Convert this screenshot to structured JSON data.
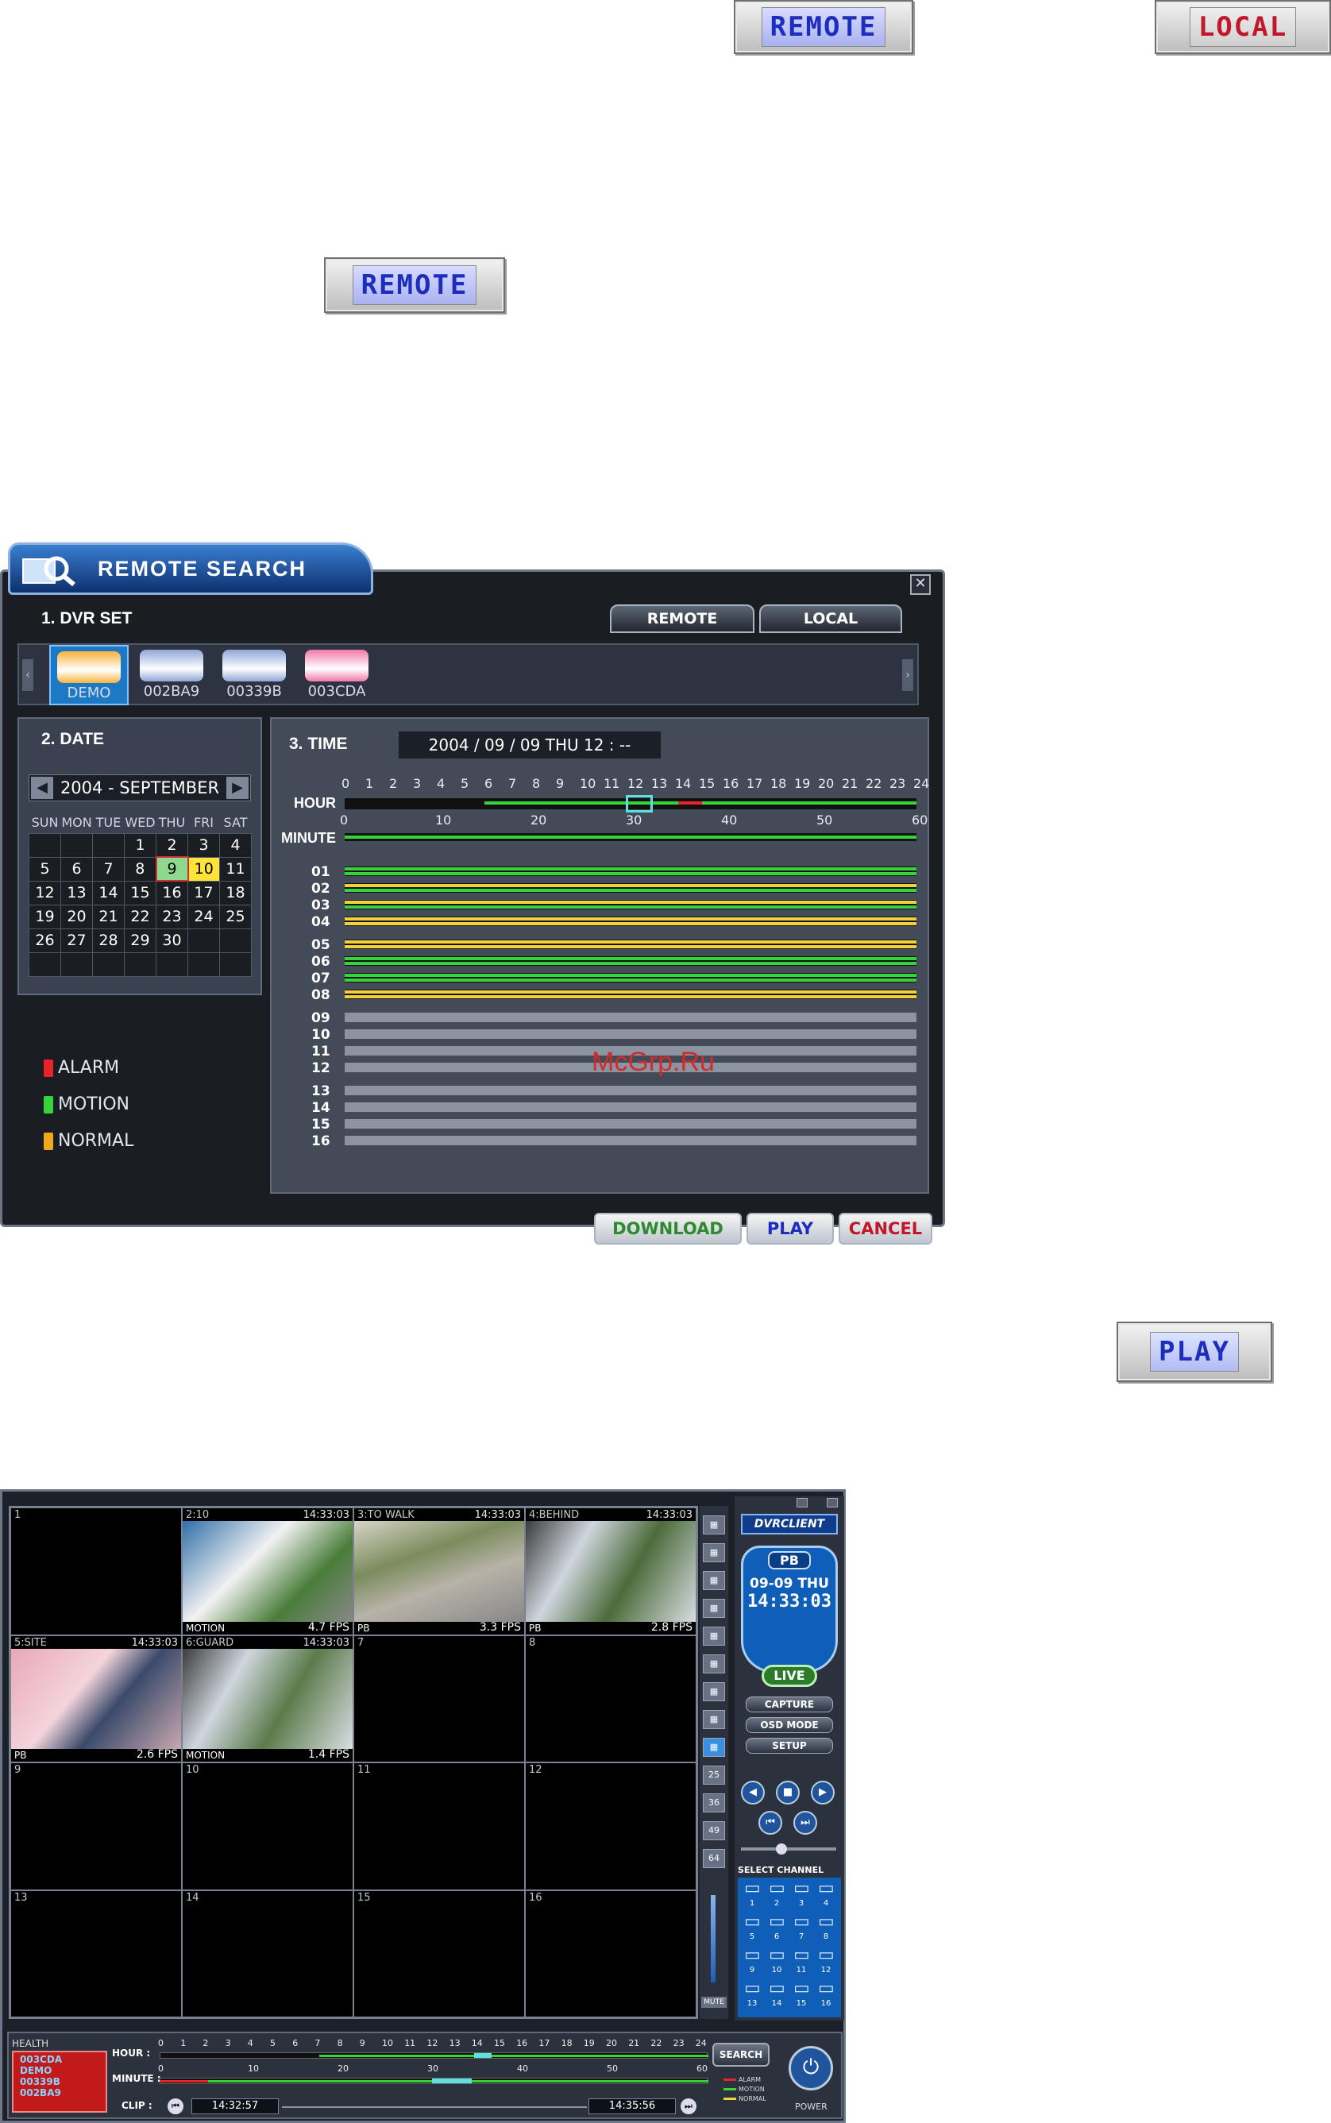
{
  "top_buttons": {
    "remote": "REMOTE",
    "local": "LOCAL",
    "remote2": "REMOTE",
    "play": "PLAY"
  },
  "dialog": {
    "title": "REMOTE SEARCH",
    "close": "✕",
    "section_dvr": "1. DVR SET",
    "tab_remote": "REMOTE",
    "tab_local": "LOCAL",
    "dvrs": [
      {
        "label": "DEMO",
        "color": "#f6b33a",
        "selected": true
      },
      {
        "label": "002BA9",
        "color": "#8ea6d8",
        "selected": false
      },
      {
        "label": "00339B",
        "color": "#8ea6d8",
        "selected": false
      },
      {
        "label": "003CDA",
        "color": "#f07aa8",
        "selected": false
      }
    ],
    "section_date": "2. DATE",
    "month": "2004 - SEPTEMBER",
    "weekdays": [
      "SUN",
      "MON",
      "TUE",
      "WED",
      "THU",
      "FRI",
      "SAT"
    ],
    "weeks": [
      [
        "",
        "",
        "",
        "1",
        "2",
        "3",
        "4"
      ],
      [
        "5",
        "6",
        "7",
        "8",
        "9",
        "10",
        "11"
      ],
      [
        "12",
        "13",
        "14",
        "15",
        "16",
        "17",
        "18"
      ],
      [
        "19",
        "20",
        "21",
        "22",
        "23",
        "24",
        "25"
      ],
      [
        "26",
        "27",
        "28",
        "29",
        "30",
        "",
        ""
      ],
      [
        "",
        "",
        "",
        "",
        "",
        "",
        ""
      ]
    ],
    "selected_day": "9",
    "highlight_day": "10",
    "legend": [
      {
        "label": "ALARM",
        "color": "#e8232a"
      },
      {
        "label": "MOTION",
        "color": "#35d43a"
      },
      {
        "label": "NORMAL",
        "color": "#f2a81c"
      }
    ],
    "section_time": "3. TIME",
    "time_value": "2004 / 09 / 09 THU 12 : --",
    "hour_label": "HOUR",
    "minute_label": "MINUTE",
    "hour_ticks": [
      "0",
      "1",
      "2",
      "3",
      "4",
      "5",
      "6",
      "7",
      "8",
      "9",
      "10",
      "11",
      "12",
      "13",
      "14",
      "15",
      "16",
      "17",
      "18",
      "19",
      "20",
      "21",
      "22",
      "23",
      "24"
    ],
    "minute_ticks": [
      "0",
      "10",
      "20",
      "30",
      "40",
      "50",
      "60"
    ],
    "channels": [
      {
        "n": "01",
        "a": "#35d43a",
        "b": "#35d43a",
        "g": false
      },
      {
        "n": "02",
        "a": "#f2d23a",
        "b": "#35d43a",
        "g": false
      },
      {
        "n": "03",
        "a": "#f2d23a",
        "b": "#35d43a",
        "g": false
      },
      {
        "n": "04",
        "a": "#f2d23a",
        "b": "#f2d23a",
        "g": false
      },
      {
        "n": "05",
        "a": "#f2d23a",
        "b": "#f2d23a",
        "g": false
      },
      {
        "n": "06",
        "a": "#35d43a",
        "b": "#35d43a",
        "g": false
      },
      {
        "n": "07",
        "a": "#35d43a",
        "b": "#35d43a",
        "g": false
      },
      {
        "n": "08",
        "a": "#f2d23a",
        "b": "#f2d23a",
        "g": false
      },
      {
        "n": "09",
        "g": true
      },
      {
        "n": "10",
        "g": true
      },
      {
        "n": "11",
        "g": true
      },
      {
        "n": "12",
        "g": true
      },
      {
        "n": "13",
        "g": true
      },
      {
        "n": "14",
        "g": true
      },
      {
        "n": "15",
        "g": true
      },
      {
        "n": "16",
        "g": true
      }
    ],
    "btn_download": "DOWNLOAD",
    "btn_play": "PLAY",
    "btn_cancel": "CANCEL"
  },
  "watermark": "McGrp.Ru",
  "client": {
    "cells": [
      {
        "num": "1",
        "tm": "",
        "fps": "",
        "st": "",
        "img": ""
      },
      {
        "num": "2:10",
        "tm": "14:33:03",
        "fps": "4.7 FPS",
        "st": "MOTION",
        "img": "linear-gradient(135deg,#2f6fa8,#f2f2f2 40%,#4a7d3a 70%,#888)"
      },
      {
        "num": "3:TO WALK",
        "tm": "14:33:03",
        "fps": "3.3 FPS",
        "st": "PB",
        "img": "linear-gradient(160deg,#d8d4c8,#7a8c5c 35%,#b8b2a8 60%,#888)"
      },
      {
        "num": "4:BEHIND",
        "tm": "14:33:03",
        "fps": "2.8 FPS",
        "st": "PB",
        "img": "linear-gradient(120deg,#3b3b3b,#cfd6de 30%,#4b6b3b 60%,#d9dde2)"
      },
      {
        "num": "5:SITE",
        "tm": "14:33:03",
        "fps": "2.6 FPS",
        "st": "PB",
        "img": "linear-gradient(130deg,#e8a8b8,#f4d4dc 40%,#3a4a6a 60%,#c8a8b0)"
      },
      {
        "num": "6:GUARD",
        "tm": "14:33:03",
        "fps": "1.4 FPS",
        "st": "MOTION",
        "img": "linear-gradient(120deg,#3b3b3b,#cfd6de 30%,#5b7b4b 60%,#d9dde2)"
      },
      {
        "num": "7",
        "tm": "",
        "fps": "",
        "st": "",
        "img": ""
      },
      {
        "num": "8",
        "tm": "",
        "fps": "",
        "st": "",
        "img": ""
      },
      {
        "num": "9",
        "tm": "",
        "fps": "",
        "st": "",
        "img": ""
      },
      {
        "num": "10",
        "tm": "",
        "fps": "",
        "st": "",
        "img": ""
      },
      {
        "num": "11",
        "tm": "",
        "fps": "",
        "st": "",
        "img": ""
      },
      {
        "num": "12",
        "tm": "",
        "fps": "",
        "st": "",
        "img": ""
      },
      {
        "num": "13",
        "tm": "",
        "fps": "",
        "st": "",
        "img": ""
      },
      {
        "num": "14",
        "tm": "",
        "fps": "",
        "st": "",
        "img": ""
      },
      {
        "num": "15",
        "tm": "",
        "fps": "",
        "st": "",
        "img": ""
      },
      {
        "num": "16",
        "tm": "",
        "fps": "",
        "st": "",
        "img": ""
      }
    ],
    "side_buttons": [
      "▦",
      "▦",
      "▦",
      "▦",
      "▦",
      "▦",
      "▦",
      "▦",
      "▦",
      "25",
      "36",
      "49",
      "64"
    ],
    "side_mute": "MUTE",
    "title": "DVRCLIENT",
    "clock_mode": "PB",
    "clock_date": "09-09 THU",
    "clock_time": "14:33:03",
    "live": "LIVE",
    "capture": "CAPTURE",
    "osd": "OSD MODE",
    "setup": "SETUP",
    "select_channel": "SELECT CHANNEL",
    "channels": [
      "1",
      "2",
      "3",
      "4",
      "5",
      "6",
      "7",
      "8",
      "9",
      "10",
      "11",
      "12",
      "13",
      "14",
      "15",
      "16"
    ],
    "health": "HEALTH",
    "health_list": [
      "003CDA",
      "DEMO",
      "00339B",
      "002BA9"
    ],
    "hour": "HOUR :",
    "minute": "MINUTE :",
    "clip": "CLIP :",
    "hour_ticks": [
      "0",
      "1",
      "2",
      "3",
      "4",
      "5",
      "6",
      "7",
      "8",
      "9",
      "10",
      "11",
      "12",
      "13",
      "14",
      "15",
      "16",
      "17",
      "18",
      "19",
      "20",
      "21",
      "22",
      "23",
      "24"
    ],
    "minute_ticks": [
      "0",
      "10",
      "20",
      "30",
      "40",
      "50",
      "60"
    ],
    "clip_start": "14:32:57",
    "clip_end": "14:35:56",
    "search": "SEARCH",
    "legend": [
      "ALARM",
      "MOTION",
      "NORMAL"
    ],
    "power": "POWER"
  }
}
